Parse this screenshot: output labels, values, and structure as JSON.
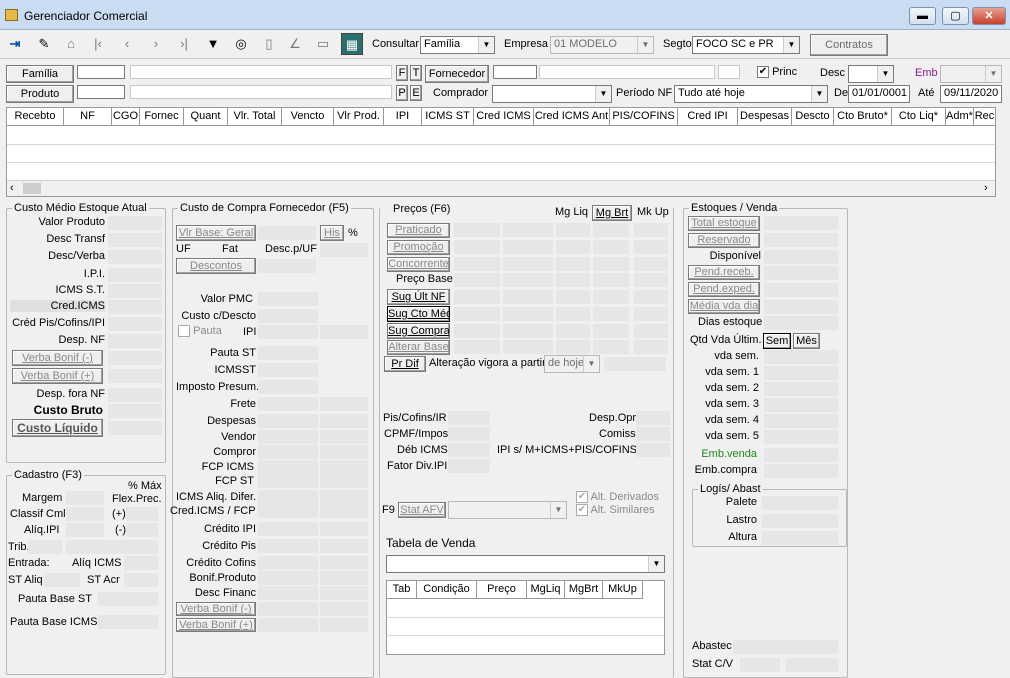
{
  "window": {
    "title": "Gerenciador Comercial",
    "minimize": "▬",
    "maximize": "▢",
    "close": "✕"
  },
  "toolbar": {
    "consultar_label": "Consultar",
    "consultar_value": "Família",
    "empresa_label": "Empresa",
    "empresa_value": "01 MODELO",
    "segto_label": "Segto",
    "segto_value": "FOCO SC e PR",
    "contratos": "Contratos"
  },
  "filters": {
    "familia": "Família",
    "produto": "Produto",
    "f": "F",
    "t": "T",
    "p": "P",
    "e": "E",
    "fornecedor": "Fornecedor",
    "comprador": "Comprador",
    "princ": "Princ",
    "desc": "Desc",
    "emb": "Emb",
    "periodo_label": "Período NF",
    "periodo_value": "Tudo até hoje",
    "de_label": "De",
    "de_value": "01/01/0001",
    "ate_label": "Até",
    "ate_value": "09/11/2020"
  },
  "grid": {
    "columns": [
      "Recebto",
      "NF",
      "CGO",
      "Fornec",
      "Quant",
      "Vlr. Total",
      "Vencto",
      "Vlr Prod.",
      "IPI",
      "ICMS ST",
      "Cred ICMS",
      "Cred ICMS Ant",
      "PIS/COFINS",
      "Cred IPI",
      "Despesas",
      "Descto",
      "Cto Bruto*",
      "Cto Liq*",
      "Adm*",
      "Rec"
    ]
  },
  "custo_medio": {
    "title": "Custo Médio Estoque Atual",
    "valor_produto": "Valor Produto",
    "desc_transf": "Desc Transf",
    "desc_verba": "Desc/Verba",
    "ipi": "I.P.I.",
    "icms_st": "ICMS S.T.",
    "cred_icms": "Cred.ICMS",
    "cred_pis": "Créd Pis/Cofins/IPI",
    "desp_nf": "Desp. NF",
    "verba_menos": "Verba Bonif (-)",
    "verba_mais": "Verba Bonif (+)",
    "desp_fora": "Desp. fora NF",
    "custo_bruto": "Custo Bruto",
    "custo_liquido": "Custo Líquido"
  },
  "cadastro": {
    "title": "Cadastro (F3)",
    "pct_max": "% Máx",
    "flex_prec": "Flex.Prec.",
    "margem": "Margem",
    "classif": "Classif Cml",
    "classif_val": "(+)",
    "aliq_ipi": "Alíq.IPI",
    "aliq_ipi_val": "(-)",
    "trib": "Trib.",
    "entrada": "Entrada:",
    "aliq_icms": "Alíq ICMS",
    "st_aliq": "ST Aliq",
    "st_acr": "ST Acr",
    "pauta_st": "Pauta Base ST",
    "pauta_icms": "Pauta Base ICMS"
  },
  "custo_compra": {
    "title": "Custo de Compra Fornecedor (F5)",
    "vlr_base": "Vlr Base: Geral",
    "his": "His",
    "pct": "%",
    "uf": "UF",
    "fat": "Fat",
    "desc_uf": "Desc.p/UF",
    "descontos": "Descontos",
    "valor_pmc": "Valor PMC",
    "custo_desc": "Custo c/Descto",
    "pauta": "Pauta",
    "ipi": "IPI",
    "pauta_st": "Pauta ST",
    "icmsst": "ICMSST",
    "imposto_presum": "Imposto Presum.",
    "frete": "Frete",
    "despesas": "Despesas",
    "vendor": "Vendor",
    "compror": "Compror",
    "fcp_icms": "FCP ICMS",
    "fcp_st": "FCP ST",
    "icms_aliq_difer": "ICMS Aliq. Difer.",
    "cred_fcp": "Cred.ICMS / FCP",
    "credito_ipi": "Crédito IPI",
    "credito_pis": "Crédito Pis",
    "credito_cofins": "Crédito Cofins",
    "bonif_produto": "Bonif.Produto",
    "desc_financ": "Desc Financ",
    "verba_menos": "Verba Bonif (-)",
    "verba_mais": "Verba Bonif (+)"
  },
  "precos": {
    "title": "Preços (F6)",
    "mg_liq": "Mg Liq",
    "mg_brt": "Mg Brt",
    "mk_up": "Mk Up",
    "praticado": "Praticado",
    "promocao": "Promoção",
    "concorrente": "Concorrente",
    "preco_base": "Preço Base",
    "sug_ult_nf": "Sug Últ NF",
    "sug_cto_med": "Sug Cto Méd",
    "sug_compra": "Sug Compra",
    "alterar_base": "Alterar Base",
    "pr_dif": "Pr Dif",
    "alteracao": "Alteração vigora a partir",
    "de_hoje": "de hoje",
    "pis_cofins_ir": "Pis/Cofins/IR",
    "cpmf": "CPMF/Impos",
    "deb_icms": "Déb ICMS",
    "fator_div": "Fator Div.IPI",
    "desp_opr": "Desp.Opr",
    "comiss": "Comiss.",
    "ipi_s": "IPI s/ M+ICMS+PIS/COFINS",
    "f9": "F9",
    "stat_afv": "Stat AFV",
    "alt_derivados": "Alt. Derivados",
    "alt_similares": "Alt. Similares",
    "tabela_venda": "Tabela de Venda",
    "tab_cols": [
      "Tab",
      "Condição",
      "Preço",
      "MgLiq",
      "MgBrt",
      "MkUp"
    ]
  },
  "estoques": {
    "title": "Estoques / Venda",
    "total_estoque": "Total estoque",
    "reservado": "Reservado",
    "disponivel": "Disponível",
    "pend_receb": "Pend.receb.",
    "pend_exped": "Pend.exped.",
    "media_vda": "Média vda dia",
    "dias_estoque": "Dias estoque",
    "qtd_vda": "Qtd Vda Últim.",
    "sem": "Sem",
    "mes": "Mês",
    "vda_sem": "vda sem.",
    "vda_sem1": "vda sem. 1",
    "vda_sem2": "vda sem. 2",
    "vda_sem3": "vda sem. 3",
    "vda_sem4": "vda sem. 4",
    "vda_sem5": "vda sem. 5",
    "emb_venda": "Emb.venda",
    "emb_compra": "Emb.compra",
    "logis": "Logís/ Abast",
    "palete": "Palete",
    "lastro": "Lastro",
    "altura": "Altura",
    "abastec": "Abastec",
    "stat_cv": "Stat C/V"
  },
  "colors": {
    "emb": "#8b1a8b",
    "emb_venda": "#1a8a1a"
  }
}
